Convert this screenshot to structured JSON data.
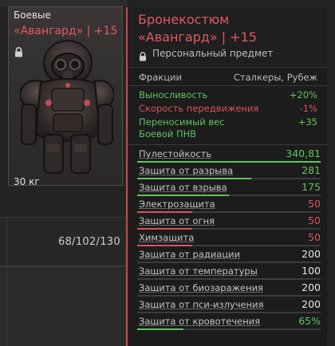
{
  "inventory": {
    "category": "Боевые",
    "item_name": "«Авангард» | +15",
    "weight": "30 кг",
    "counter": "68/102/130",
    "accent_color": "#e05a5f"
  },
  "tooltip": {
    "title_line1": "Бронекостюм",
    "title_line2": "«Авангард» | +15",
    "personal": "Персональный предмет",
    "factions_label": "Фракции",
    "factions_value": "Сталкеры, Рубеж",
    "bonuses": [
      {
        "label": "Выносливость",
        "value": "+20%",
        "color": "green"
      },
      {
        "label": "Скорость передвижения",
        "value": "-1%",
        "color": "red"
      },
      {
        "label": "Переносимый вес",
        "value": "+35",
        "color": "green"
      },
      {
        "label": "Боевой ПНВ",
        "value": "",
        "color": "green"
      }
    ],
    "stats": [
      {
        "label": "Пулестойкость",
        "value": "340,81",
        "color": "green",
        "bar": 1.0
      },
      {
        "label": "Защита от разрыва",
        "value": "281",
        "color": "green",
        "bar": 0.62
      },
      {
        "label": "Защита от взрыва",
        "value": "175",
        "color": "green",
        "bar": 0.5
      },
      {
        "label": "Электрозащита",
        "value": "50",
        "color": "red",
        "bar": 0.3
      },
      {
        "label": "Защита от огня",
        "value": "50",
        "color": "red",
        "bar": 0.3
      },
      {
        "label": "Химзащита",
        "value": "50",
        "color": "red",
        "bar": 0.3
      },
      {
        "label": "Защита от радиации",
        "value": "200",
        "color": "white",
        "bar": 0.0
      },
      {
        "label": "Защита от температуры",
        "value": "100",
        "color": "white",
        "bar": 0.0
      },
      {
        "label": "Защита от биозаражения",
        "value": "200",
        "color": "white",
        "bar": 0.0
      },
      {
        "label": "Защита от пси-излучения",
        "value": "200",
        "color": "white",
        "bar": 0.0
      },
      {
        "label": "Защита от кровотечения",
        "value": "65%",
        "color": "green",
        "bar": 0.25
      }
    ]
  },
  "colors": {
    "green": "#5fc35f",
    "red": "#d9535a",
    "white": "#e6e6e6",
    "accent": "#c94a51"
  },
  "icons": {
    "lock": "lock-icon"
  }
}
